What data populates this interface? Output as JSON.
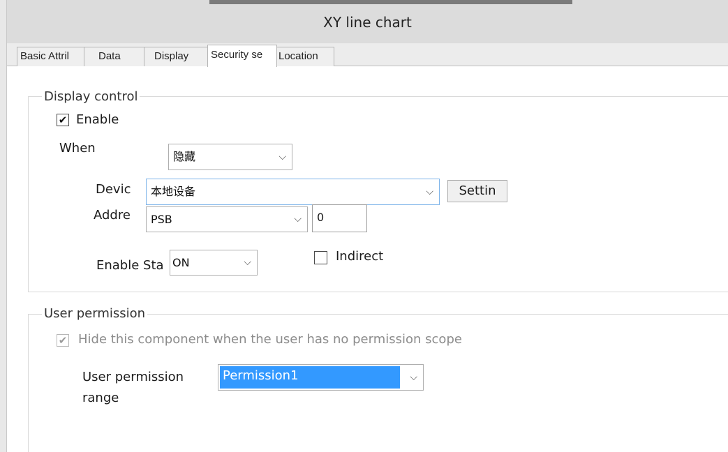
{
  "window": {
    "title": "XY line chart"
  },
  "tabs": [
    {
      "label": "Basic Attril"
    },
    {
      "label": "Data"
    },
    {
      "label": "Display"
    },
    {
      "label": "Security se"
    },
    {
      "label": "Location"
    }
  ],
  "display_control": {
    "legend": "Display control",
    "enable_label": "Enable",
    "enable_checked": true,
    "when_label": "When",
    "when_value": "隐藏",
    "device_label": "Devic",
    "device_value": "本地设备",
    "settings_button": "Settin",
    "address_label": "Addre",
    "address_type": "PSB",
    "address_value": "0",
    "enable_state_label": "Enable Sta",
    "enable_state_value": "ON",
    "indirect_label": "Indirect",
    "indirect_checked": false
  },
  "user_permission": {
    "legend": "User permission",
    "hide_label": "Hide this component when the user has no permission scope",
    "hide_checked": true,
    "range_label_line1": "User permission",
    "range_label_line2": "range",
    "range_value": "Permission1"
  },
  "icons": {
    "check": "✔",
    "chevron": "⌵"
  },
  "colors": {
    "selection": "#3399ff"
  }
}
